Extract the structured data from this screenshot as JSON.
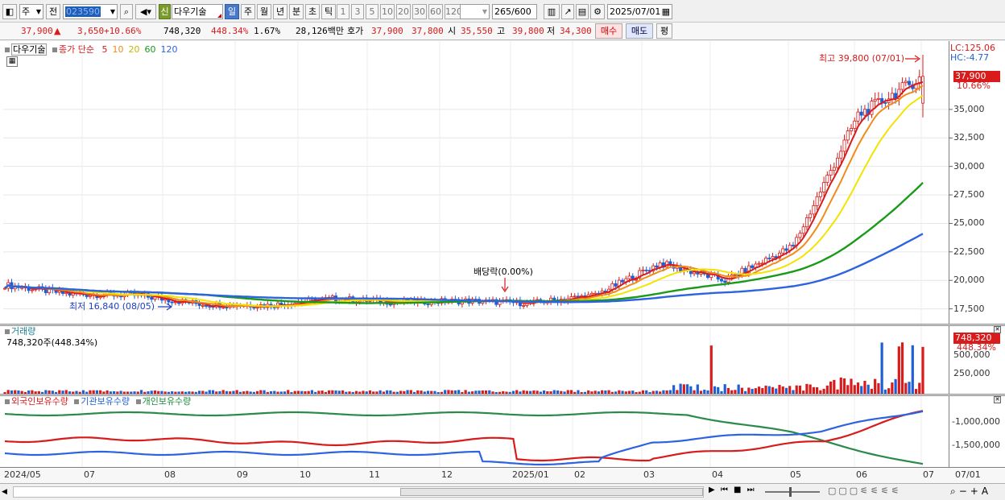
{
  "toolbar": {
    "market": "주",
    "prev": "전",
    "code": "023590",
    "new_badge": "신",
    "name": "다우기술",
    "periods": [
      "일",
      "주",
      "월",
      "년",
      "분",
      "초",
      "틱"
    ],
    "minutes": [
      "1",
      "3",
      "5",
      "10",
      "20",
      "30",
      "60",
      "120"
    ],
    "count": "265",
    "count_max": "/600",
    "date": "2025/07/01"
  },
  "quote": {
    "price": "37,900",
    "up_mark": "▲",
    "change": "3,650",
    "change_pct": "+10.66%",
    "volume": "748,320",
    "vol_ratio": "448.34%",
    "turnover": "1.67%",
    "amount": "28,126백만",
    "ask_label": "호가",
    "ask": "37,900",
    "bid": "37,800",
    "open_label": "시",
    "open": "35,550",
    "high_label": "고",
    "high": "39,800",
    "low_label": "저",
    "low": "34,300",
    "buy_button": "매수",
    "sell_button": "매도",
    "eval_button": "평"
  },
  "legend": {
    "stock": "다우기술",
    "ma_label": "종가 단순",
    "ma": [
      {
        "period": "5",
        "color": "#d81b1b"
      },
      {
        "period": "10",
        "color": "#f08c19"
      },
      {
        "period": "20",
        "color": "#f2e400"
      },
      {
        "period": "60",
        "color": "#1a9a1a"
      },
      {
        "period": "120",
        "color": "#2e63e0"
      }
    ]
  },
  "annotations": {
    "high_label": "최고 39,800 (07/01)",
    "low_label": "최저 16,840 (08/05)",
    "dividend": "배당락(0.00%)",
    "lc": "LC:125.06",
    "hc": "HC:-4.77",
    "price_tag": "37,900",
    "pct_tag": "10.66%"
  },
  "volume_panel": {
    "title": "거래량",
    "value": "748,320주(448.34%)",
    "tag": "748,320",
    "tag_pct": "448.34%"
  },
  "investor_panel": {
    "foreign": "외국인보유수량",
    "institution": "기관보유수량",
    "individual": "개인보유수량"
  },
  "axes": {
    "price_ticks": [
      "35,000",
      "32,500",
      "30,000",
      "27,500",
      "25,000",
      "22,500",
      "20,000",
      "17,500"
    ],
    "volume_ticks": [
      "500,000",
      "250,000"
    ],
    "holding_ticks": [
      "-1,000,000",
      "-1,500,000"
    ],
    "x_ticks": [
      "2024/05",
      "07",
      "08",
      "09",
      "10",
      "11",
      "12",
      "2025/01",
      "02",
      "03",
      "04",
      "05",
      "06",
      "07",
      "07/01"
    ]
  },
  "colors": {
    "up": "#d81b1b",
    "down": "#1f5fd6",
    "ma5": "#d81b1b",
    "ma10": "#f08c19",
    "ma20": "#f2e400",
    "ma60": "#1a9a1a",
    "ma120": "#2e63e0"
  },
  "chart_data": {
    "type": "candlestick",
    "period": "daily",
    "x_range": [
      "2024/05",
      "2025/07/01"
    ],
    "y_ticks": [
      17500,
      20000,
      22500,
      25000,
      27500,
      30000,
      32500,
      35000
    ],
    "approx_monthly_close": [
      {
        "x": "2024/05",
        "close": 19600
      },
      {
        "x": "2024/06",
        "close": 18800
      },
      {
        "x": "2024/07",
        "close": 18700
      },
      {
        "x": "2024/08",
        "close": 17900
      },
      {
        "x": "2024/09",
        "close": 17800
      },
      {
        "x": "2024/10",
        "close": 18400
      },
      {
        "x": "2024/11",
        "close": 18100
      },
      {
        "x": "2024/12",
        "close": 18200
      },
      {
        "x": "2025/01",
        "close": 18000
      },
      {
        "x": "2025/02",
        "close": 18700
      },
      {
        "x": "2025/03",
        "close": 21500
      },
      {
        "x": "2025/04",
        "close": 20000
      },
      {
        "x": "2025/05",
        "close": 23000
      },
      {
        "x": "2025/06",
        "close": 34500
      },
      {
        "x": "2025/07/01",
        "close": 37900
      }
    ],
    "last_candle": {
      "date": "2025/07/01",
      "open": 35550,
      "high": 39800,
      "low": 34300,
      "close": 37900,
      "volume": 748320
    },
    "high": {
      "value": 39800,
      "date": "07/01"
    },
    "low": {
      "value": 16840,
      "date": "08/05"
    },
    "moving_averages": [
      "5",
      "10",
      "20",
      "60",
      "120"
    ]
  }
}
